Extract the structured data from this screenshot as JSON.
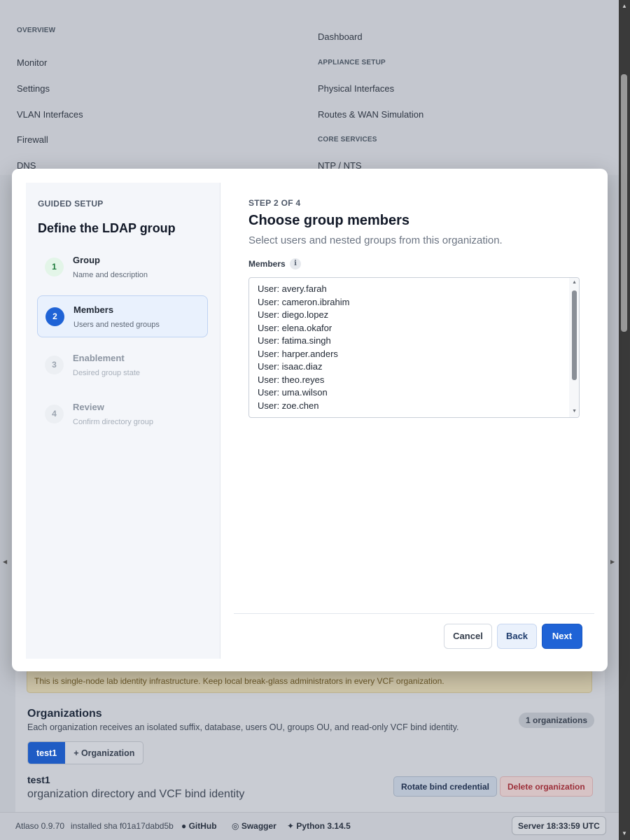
{
  "nav": {
    "overview_heading": "OVERVIEW",
    "appliance_heading": "APPLIANCE SETUP",
    "core_heading": "CORE SERVICES",
    "items": {
      "dashboard": "Dashboard",
      "monitor": "Monitor",
      "settings": "Settings",
      "physical_interfaces": "Physical Interfaces",
      "vlan_interfaces": "VLAN Interfaces",
      "routes": "Routes & WAN Simulation",
      "firewall": "Firewall",
      "dns": "DNS",
      "ntp": "NTP / NTS"
    }
  },
  "page": {
    "warning": "This is single-node lab identity infrastructure. Keep local break-glass administrators in every VCF organization.",
    "organizations_title": "Organizations",
    "organizations_desc": "Each organization receives an isolated suffix, database, users OU, groups OU, and read-only VCF bind identity.",
    "organizations_count": "1 organizations",
    "tabs": [
      "test1",
      "+ Organization"
    ],
    "org_name": "test1",
    "org_subtitle": "organization directory and VCF bind identity",
    "rotate_label": "Rotate bind credential",
    "delete_label": "Delete organization"
  },
  "footer": {
    "version": "Atlaso 0.9.70",
    "sha": "installed sha f01a17dabd5b",
    "github": "GitHub",
    "swagger": "Swagger",
    "python": "Python 3.14.5",
    "server_time": "Server 18:33:59 UTC"
  },
  "modal": {
    "sidebar_label": "GUIDED SETUP",
    "sidebar_title": "Define the LDAP group",
    "steps": [
      {
        "num": "1",
        "title": "Group",
        "subtitle": "Name and description",
        "state": "done"
      },
      {
        "num": "2",
        "title": "Members",
        "subtitle": "Users and nested groups",
        "state": "current"
      },
      {
        "num": "3",
        "title": "Enablement",
        "subtitle": "Desired group state",
        "state": "future"
      },
      {
        "num": "4",
        "title": "Review",
        "subtitle": "Confirm directory group",
        "state": "future"
      }
    ],
    "step_label": "STEP 2 OF 4",
    "title": "Choose group members",
    "description": "Select users and nested groups from this organization.",
    "members_label": "Members",
    "members": [
      "User: avery.farah",
      "User: cameron.ibrahim",
      "User: diego.lopez",
      "User: elena.okafor",
      "User: fatima.singh",
      "User: harper.anders",
      "User: isaac.diaz",
      "User: theo.reyes",
      "User: uma.wilson",
      "User: zoe.chen"
    ],
    "cancel_label": "Cancel",
    "back_label": "Back",
    "next_label": "Next"
  },
  "colors": {
    "primary": "#1f63d6",
    "step_done": "#1d7a3b",
    "danger": "#9c2f39",
    "warning_bg": "#cfc6a9"
  }
}
